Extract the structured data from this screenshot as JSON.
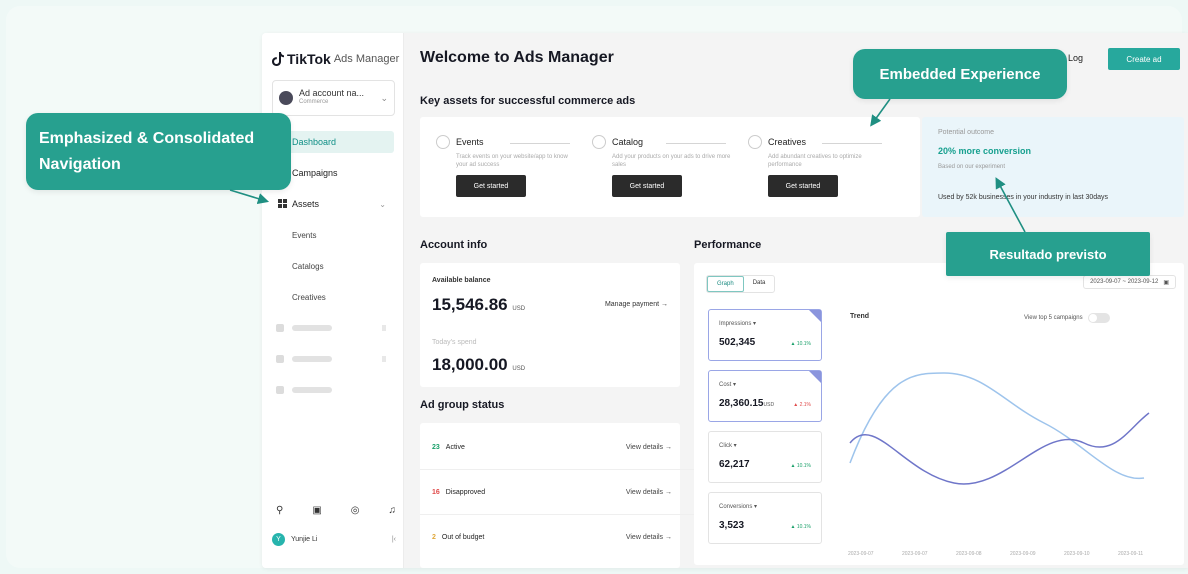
{
  "sidebar": {
    "brand": "TikTok",
    "brand_sub": "Ads Manager",
    "account_name": "Ad account na...",
    "account_type": "Commerce",
    "nav": {
      "dashboard": "Dashboard",
      "campaigns": "Campaigns",
      "assets": "Assets",
      "events": "Events",
      "catalogs": "Catalogs",
      "creatives": "Creatives"
    },
    "user_name": "Yunjie Li",
    "user_initial": "Y"
  },
  "header": {
    "title": "Welcome to Ads Manager",
    "log_label": "Log",
    "create_label": "Create ad"
  },
  "key_assets": {
    "title": "Key assets for successful commerce ads",
    "items": [
      {
        "title": "Events",
        "desc": "Track events on your website/app to know your ad success",
        "button": "Get started"
      },
      {
        "title": "Catalog",
        "desc": "Add your products on your ads to drive more sales",
        "button": "Get started"
      },
      {
        "title": "Creatives",
        "desc": "Add abundant creatives to optimize performance",
        "button": "Get started"
      }
    ]
  },
  "outcome": {
    "label": "Potential outcome",
    "value": "20% more conversion",
    "sub": "Based on our experiment",
    "used_by": "Used by 52k businesses in your industry in last 30days"
  },
  "account_info": {
    "title": "Account info",
    "balance_label": "Available balance",
    "balance_value": "15,546.86",
    "currency": "USD",
    "manage": "Manage payment →",
    "spend_label": "Today's spend",
    "spend_value": "18,000.00"
  },
  "ad_group_status": {
    "title": "Ad group status",
    "rows": [
      {
        "count": "23",
        "label": "Active",
        "link": "View details →",
        "color": "#1aa06a"
      },
      {
        "count": "16",
        "label": "Disapproved",
        "link": "View details →",
        "color": "#e04a4a"
      },
      {
        "count": "2",
        "label": "Out of budget",
        "link": "View details →",
        "color": "#e0a83a"
      }
    ]
  },
  "performance": {
    "title": "Performance",
    "tabs": [
      "Graph",
      "Data"
    ],
    "date_range": "2023-09-07 ~ 2023-09-12",
    "metrics": [
      {
        "name": "Impressions ▾",
        "value": "502,345",
        "unit": "",
        "change": "▲ 10.1%",
        "negative": false,
        "selected": true
      },
      {
        "name": "Cost ▾",
        "value": "28,360.15",
        "unit": "USD",
        "change": "▲ 2.1%",
        "negative": true,
        "selected": true
      },
      {
        "name": "Click ▾",
        "value": "62,217",
        "unit": "",
        "change": "▲ 10.1%",
        "negative": false,
        "selected": false
      },
      {
        "name": "Conversions ▾",
        "value": "3,523",
        "unit": "",
        "change": "▲ 10.1%",
        "negative": false,
        "selected": false
      }
    ],
    "trend_label": "Trend",
    "view_top": "View top 5 campaigns",
    "x_labels": [
      "2023-09-07",
      "2023-09-07",
      "2023-09-08",
      "2023-09-09",
      "2023-09-10",
      "2023-09-11"
    ]
  },
  "callouts": {
    "navigation": "Emphasized & Consolidated Navigation",
    "embedded": "Embedded Experience",
    "resultado": "Resultado previsto"
  },
  "colors": {
    "accent": "#27a08f",
    "series_light": "#9ec4ec",
    "series_dark": "#6f76c9"
  }
}
